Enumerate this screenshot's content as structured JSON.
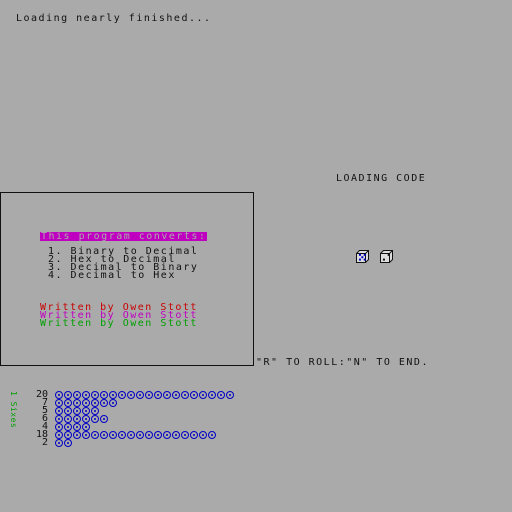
{
  "status_line": "Loading nearly finished...",
  "loading_code": "LOADING CODE",
  "roll_hint": "\"R\" TO ROLL:\"N\" TO END.",
  "panel": {
    "title": "This program converts:",
    "menu": [
      "1. Binary to Decimal",
      "2. Hex to Decimal",
      "3. Decimal to Binary",
      "4. Decimal to Hex"
    ],
    "credits": [
      {
        "text": "Written by Owen Stott",
        "color": "#c80000"
      },
      {
        "text": "Written by Owen Stott",
        "color": "#c000c0"
      },
      {
        "text": "Written by Owen Stott",
        "color": "#00a000"
      }
    ]
  },
  "dice": [
    {
      "pips": 5,
      "color": "#0000c8"
    },
    {
      "pips": 2,
      "color": "#111111"
    }
  ],
  "histogram": {
    "axis_label": "1 Sixes",
    "counts": [
      {
        "label": "20",
        "value": 20
      },
      {
        "label": "7",
        "value": 7
      },
      {
        "label": "5",
        "value": 5
      },
      {
        "label": "6",
        "value": 6
      },
      {
        "label": "4",
        "value": 4
      },
      {
        "label": "18",
        "value": 18
      },
      {
        "label": "2",
        "value": 2
      }
    ],
    "circle_color": "#0000c8"
  }
}
